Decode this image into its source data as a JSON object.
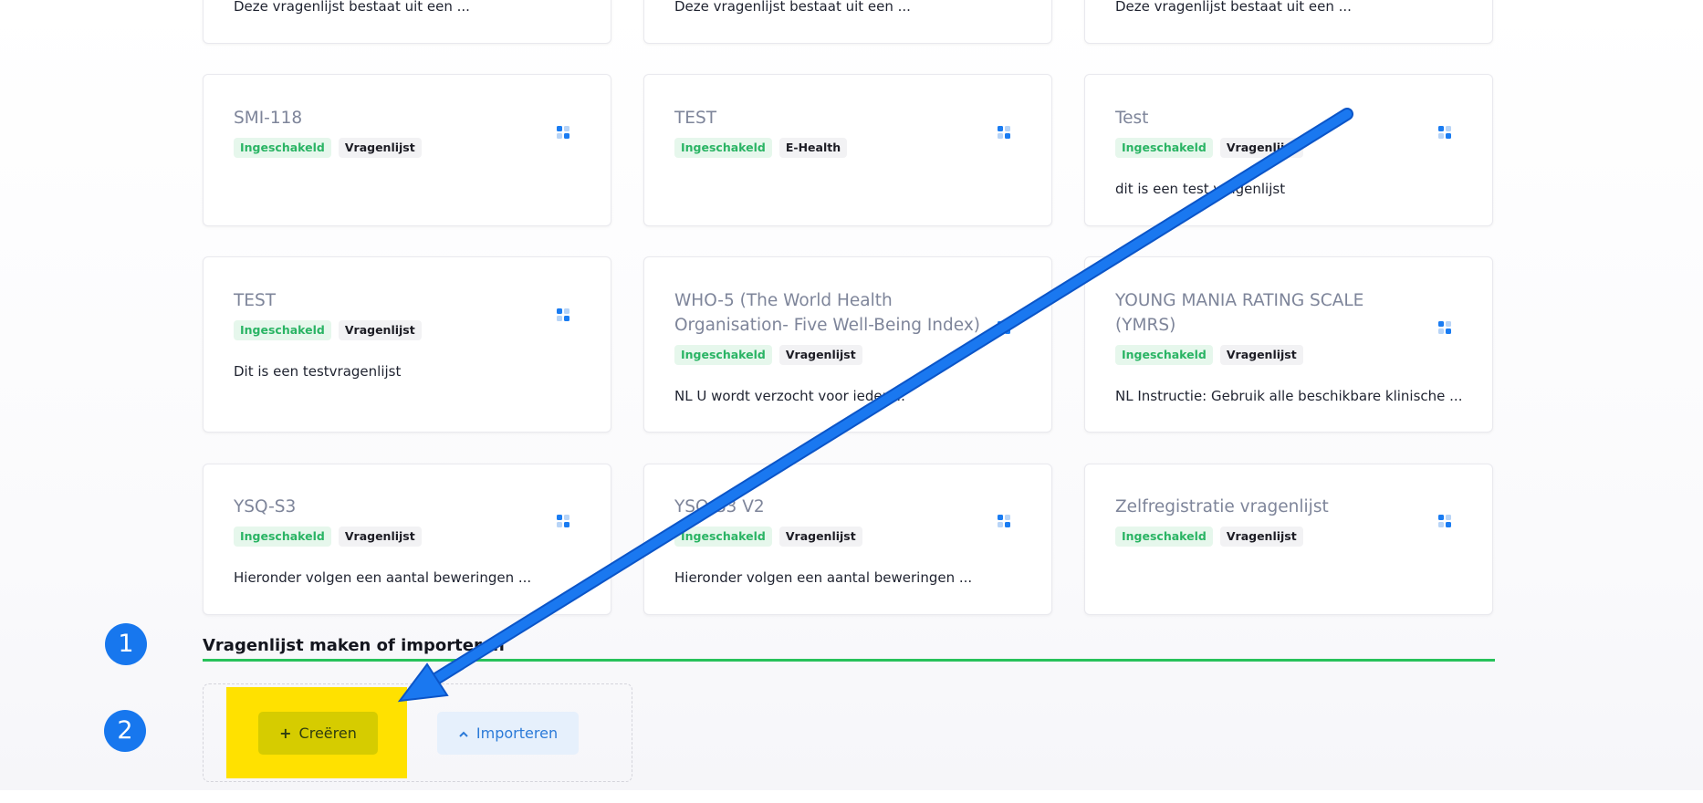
{
  "top_cards": [
    {
      "description": "Deze vragenlijst bestaat uit een ..."
    },
    {
      "description": "Deze vragenlijst bestaat uit een ..."
    },
    {
      "description": "Deze vragenlijst bestaat uit een ..."
    }
  ],
  "cards": [
    {
      "title": "SMI-118",
      "status": "Ingeschakeld",
      "type": "Vragenlijst",
      "description": ""
    },
    {
      "title": "TEST",
      "status": "Ingeschakeld",
      "type": "E-Health",
      "description": ""
    },
    {
      "title": "Test",
      "status": "Ingeschakeld",
      "type": "Vragenlijst",
      "description": "dit is een test vragenlijst"
    },
    {
      "title": "TEST",
      "status": "Ingeschakeld",
      "type": "Vragenlijst",
      "description": "Dit is een testvragenlijst"
    },
    {
      "title": "WHO-5 (The World Health Organisation- Five Well-Being Index)",
      "status": "Ingeschakeld",
      "type": "Vragenlijst",
      "description": "NL U wordt verzocht voor ieder ..."
    },
    {
      "title": "YOUNG MANIA RATING SCALE (YMRS)",
      "status": "Ingeschakeld",
      "type": "Vragenlijst",
      "description": "NL Instructie: Gebruik alle beschikbare klinische ..."
    },
    {
      "title": "YSQ-S3",
      "status": "Ingeschakeld",
      "type": "Vragenlijst",
      "description": "Hieronder volgen een aantal beweringen ..."
    },
    {
      "title": "YSQ-S3 V2",
      "status": "Ingeschakeld",
      "type": "Vragenlijst",
      "description": "Hieronder volgen een aantal beweringen ..."
    },
    {
      "title": "Zelfregistratie vragenlijst",
      "status": "Ingeschakeld",
      "type": "Vragenlijst",
      "description": ""
    }
  ],
  "section": {
    "title": "Vragenlijst maken of importeren",
    "create_label": "Creëren",
    "import_label": "Importeren"
  },
  "annotations": {
    "step1": "1",
    "step2": "2"
  },
  "colors": {
    "accent": "#1777ee",
    "enabled": "#2ab464",
    "highlight": "#ffe100",
    "section_line": "#27c25a"
  }
}
